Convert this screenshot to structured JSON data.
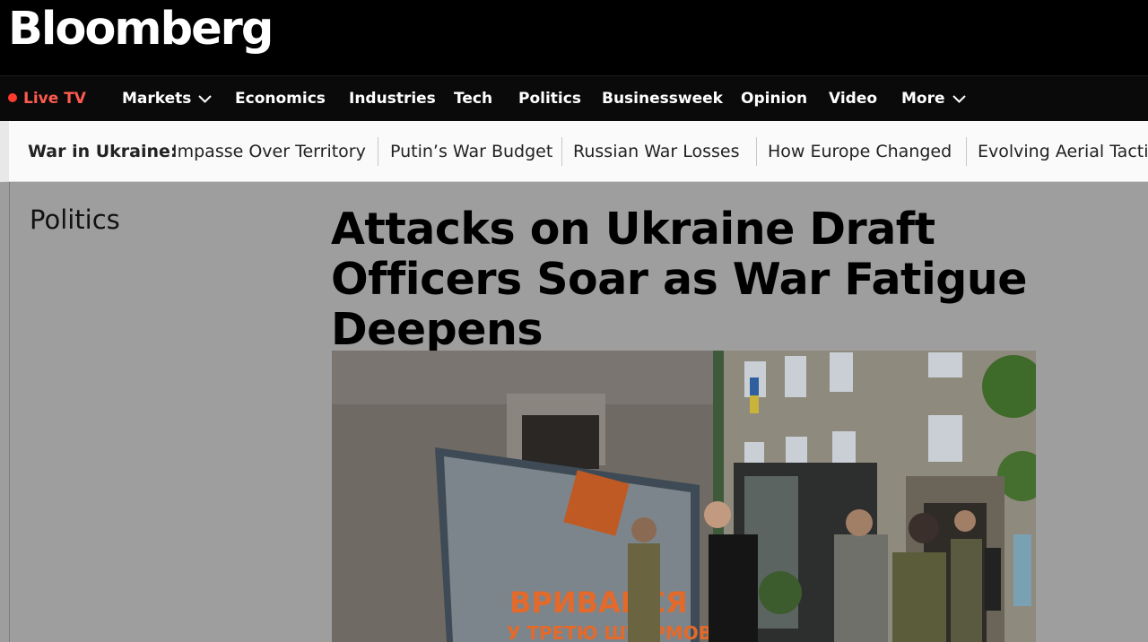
{
  "brand": {
    "logo_text": "Bloomberg"
  },
  "nav": {
    "live_label": "Live TV",
    "items": [
      {
        "label": "Markets",
        "has_dropdown": true
      },
      {
        "label": "Economics"
      },
      {
        "label": "Industries"
      },
      {
        "label": "Tech"
      },
      {
        "label": "Politics"
      },
      {
        "label": "Businessweek"
      },
      {
        "label": "Opinion"
      },
      {
        "label": "Video"
      },
      {
        "label": "More",
        "has_dropdown": true
      }
    ]
  },
  "subnav": {
    "label": "War in Ukraine:",
    "links": [
      "Impasse Over Territory",
      "Putin’s War Budget",
      "Russian War Losses",
      "How Europe Changed",
      "Evolving Aerial Tactics"
    ]
  },
  "article": {
    "section": "Politics",
    "headline": "Attacks on Ukraine Draft Officers Soar as War Fatigue Deepens",
    "hero_poster_text_1": "ВРИВАЙСЯ",
    "hero_poster_text_2": "У ТРЕТЮ ШТУРМОВУ"
  },
  "colors": {
    "live": "#ff5a4f",
    "masthead": "#000000",
    "overlay": "#9e9e9e"
  }
}
